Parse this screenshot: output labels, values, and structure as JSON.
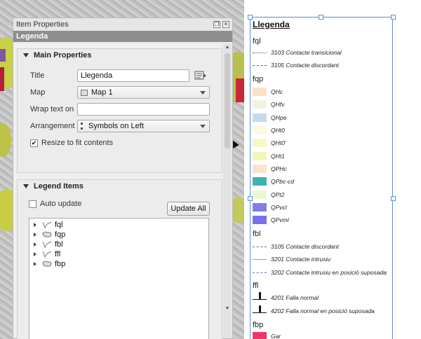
{
  "dock": {
    "title": "Item Properties",
    "header": "Legenda"
  },
  "main_properties": {
    "section_title": "Main Properties",
    "title_label": "Title",
    "title_value": "Llegenda",
    "map_label": "Map",
    "map_value": "Map 1",
    "wrap_label": "Wrap text on",
    "wrap_value": "",
    "arrangement_label": "Arrangement",
    "arrangement_value": "Symbols on Left",
    "resize_label": "Resize to fit contents",
    "resize_checked": true
  },
  "legend_items": {
    "section_title": "Legend Items",
    "auto_update_label": "Auto update",
    "update_all_label": "Update All",
    "tree": [
      {
        "label": "fql",
        "icon": "line-layer-icon"
      },
      {
        "label": "fqp",
        "icon": "polygon-layer-icon"
      },
      {
        "label": "fbl",
        "icon": "line-layer-icon"
      },
      {
        "label": "ffl",
        "icon": "line-layer-icon"
      },
      {
        "label": "fbp",
        "icon": "polygon-layer-icon"
      }
    ]
  },
  "legend_canvas": {
    "title": "Llegenda",
    "groups": [
      {
        "name": "fql"
      },
      {
        "name": "fqp"
      },
      {
        "name": "fbl"
      },
      {
        "name": "ffl"
      },
      {
        "name": "fbp"
      }
    ],
    "items": [
      {
        "label": "3103 Contacte transicional",
        "symbol": "dotted-line"
      },
      {
        "label": "3105 Contacte discordant",
        "symbol": "dash-dot-line"
      },
      {
        "label": "QHc",
        "color": "#fbe0c8"
      },
      {
        "label": "QHfv",
        "color": "#f2f2e2"
      },
      {
        "label": "QHpe",
        "color": "#cfe3ef"
      },
      {
        "label": "QHt0",
        "color": "#fafbe2"
      },
      {
        "label": "QHt0'",
        "color": "#f6f9c4"
      },
      {
        "label": "QHt1",
        "color": "#f1f7b4"
      },
      {
        "label": "QPHc",
        "color": "#fbe3cc"
      },
      {
        "label": "QPbc-cd",
        "color": "#3fb3b1"
      },
      {
        "label": "QPt2",
        "color": "#edf7d4"
      },
      {
        "label": "QPvcl",
        "color": "#8d87e8"
      },
      {
        "label": "QPvml",
        "color": "#7a70ee"
      },
      {
        "label": "3105 Contacte discordant",
        "symbol": "dash-dot-line"
      },
      {
        "label": "3201 Contacte intrusiu",
        "symbol": "solid-line"
      },
      {
        "label": "3202 Contacte intrusiu en posició suposada",
        "symbol": "dashed-line"
      },
      {
        "label": "4201 Falla normal",
        "symbol": "fault-line"
      },
      {
        "label": "4202 Falla normal en posició suposada",
        "symbol": "fault-line"
      },
      {
        "label": "Gar",
        "color": "#f0356a"
      }
    ]
  }
}
